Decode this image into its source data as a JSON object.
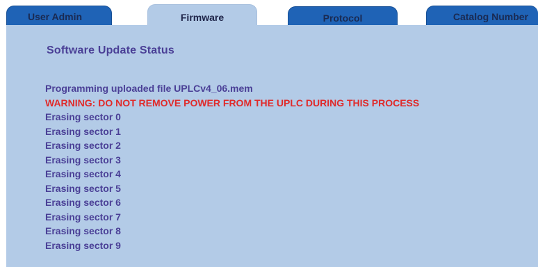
{
  "tabs": {
    "user_admin": "User Admin",
    "firmware": "Firmware",
    "protocol": "Protocol",
    "catalog_number": "Catalog Number",
    "active": "Firmware"
  },
  "status": {
    "title": "Software Update Status",
    "upload_message": "Programming uploaded file UPLCv4_06.mem",
    "warning": "WARNING: DO NOT REMOVE POWER FROM THE UPLC DURING THIS PROCESS",
    "sectors": [
      "Erasing sector 0",
      "Erasing sector 1",
      "Erasing sector 2",
      "Erasing sector 3",
      "Erasing sector 4",
      "Erasing sector 5",
      "Erasing sector 6",
      "Erasing sector 7",
      "Erasing sector 8",
      "Erasing sector 9"
    ]
  },
  "colors": {
    "tab_inactive": "#1f63b6",
    "panel": "#b3cbe7",
    "text": "#4a3f96",
    "warning": "#e02a2a"
  }
}
